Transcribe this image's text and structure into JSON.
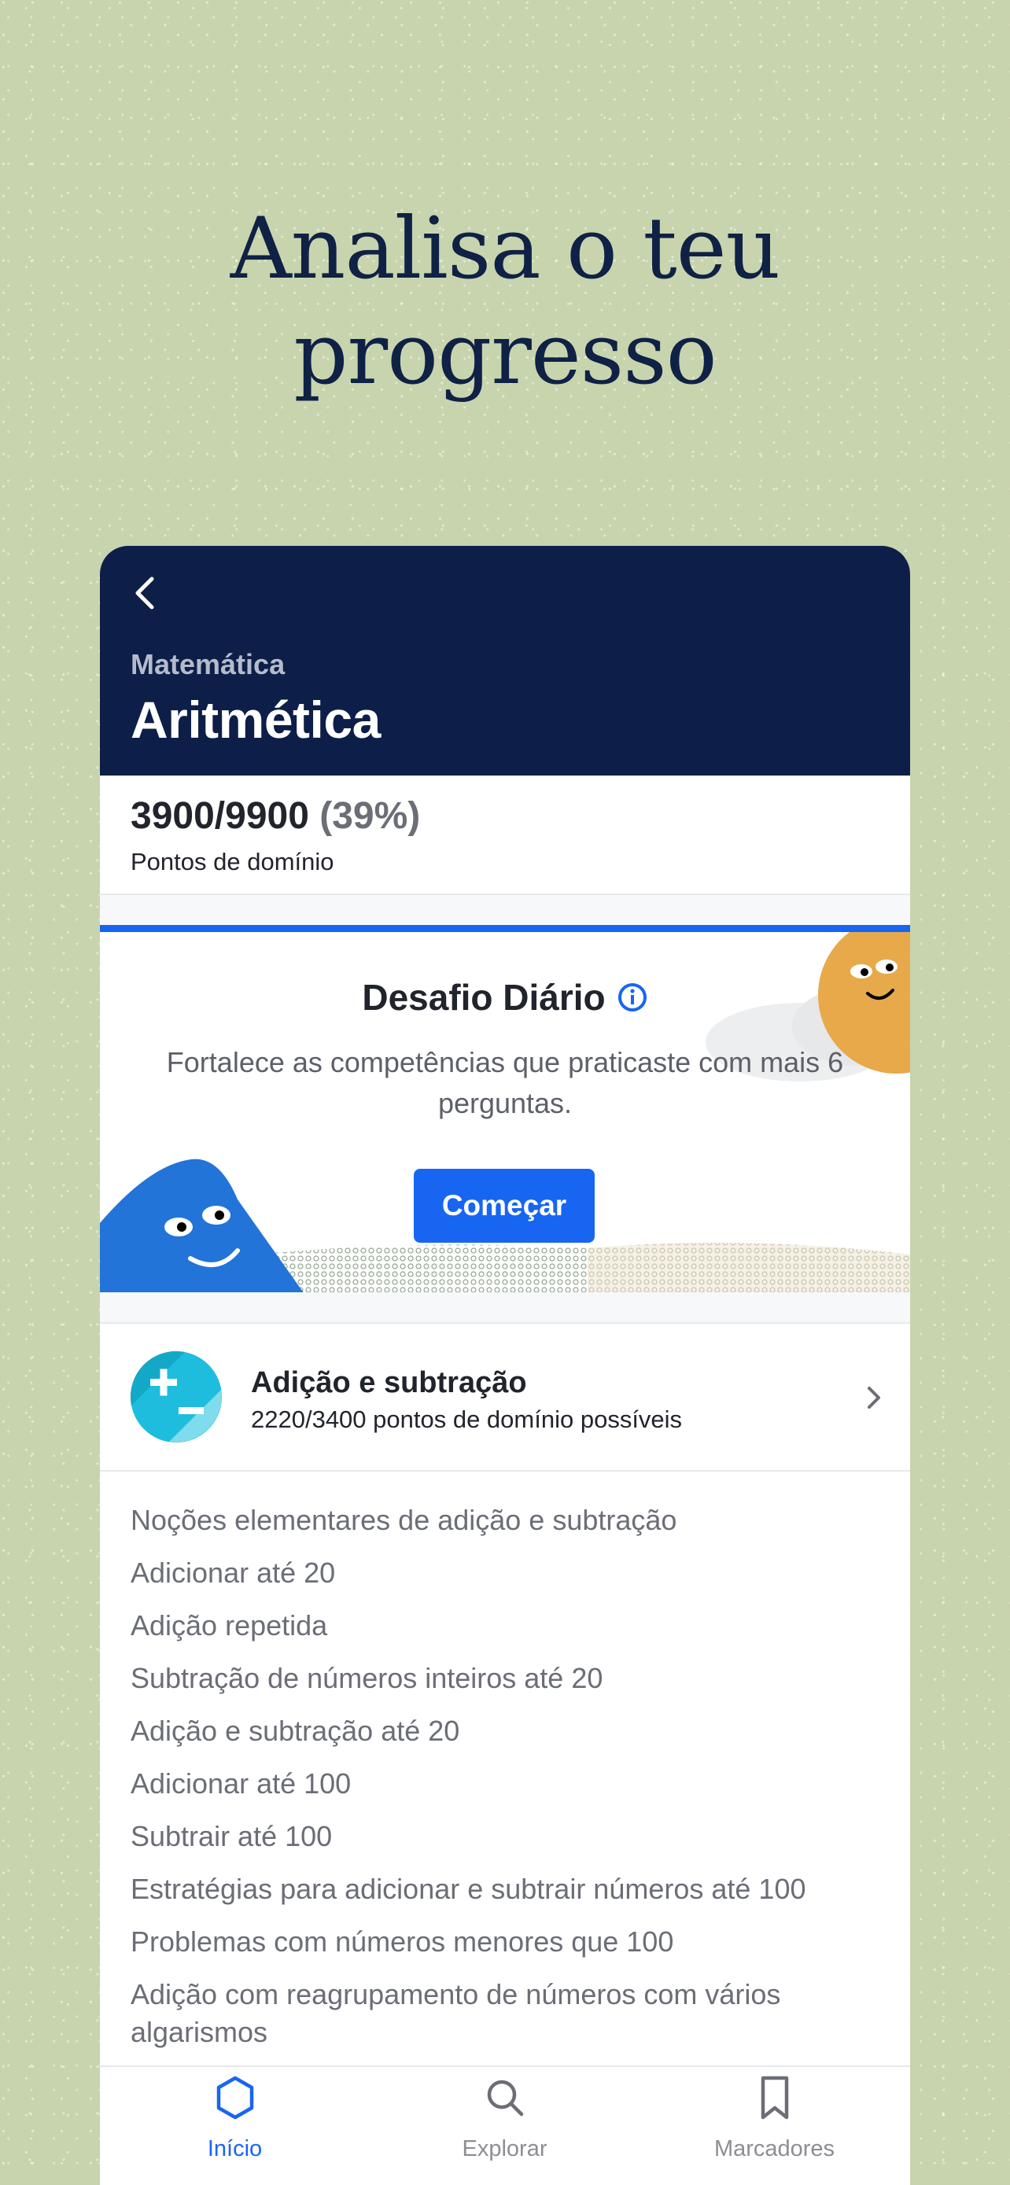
{
  "headline": {
    "line1": "Analisa o teu",
    "line2": "progresso"
  },
  "header": {
    "subject": "Matemática",
    "title": "Aritmética"
  },
  "mastery": {
    "points": "3900/9900",
    "percent": "(39%)",
    "label": "Pontos de domínio"
  },
  "daily_challenge": {
    "title": "Desafio Diário",
    "description": "Fortalece as competências que praticaste com mais 6 perguntas.",
    "button": "Começar"
  },
  "skill": {
    "name": "Adição e subtração",
    "subtitle": "2220/3400 pontos de domínio possíveis"
  },
  "topics": [
    "Noções elementares de adição e subtração",
    "Adicionar até 20",
    "Adição repetida",
    "Subtração de números inteiros até 20",
    "Adição e subtração até 20",
    "Adicionar até 100",
    "Subtrair até 100",
    "Estratégias para adicionar e subtrair números até 100",
    "Problemas com números menores que 100",
    "Adição com reagrupamento de números com vários algarismos"
  ],
  "tabs": [
    {
      "label": "Início",
      "icon": "hexagon-icon",
      "active": true
    },
    {
      "label": "Explorar",
      "icon": "search-icon",
      "active": false
    },
    {
      "label": "Marcadores",
      "icon": "bookmark-icon",
      "active": false
    }
  ],
  "colors": {
    "background": "#c8d4ad",
    "header": "#0d1f48",
    "accent": "#1865f2",
    "text": "#21242c"
  }
}
